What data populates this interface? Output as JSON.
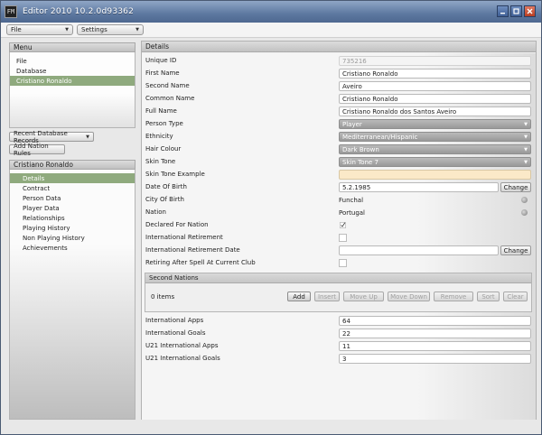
{
  "window": {
    "title": "Editor 2010 10.2.0d93362",
    "app_icon": "FM"
  },
  "menubar": {
    "file": "File",
    "settings": "Settings"
  },
  "menu_panel": {
    "title": "Menu",
    "items": [
      "File",
      "Database",
      "Cristiano Ronaldo"
    ],
    "selected_index": 2
  },
  "buttons": {
    "recent_records": "Recent Database Records",
    "add_nation_rules": "Add Nation Rules",
    "change": "Change"
  },
  "player_panel": {
    "title": "Cristiano Ronaldo",
    "items": [
      "Details",
      "Contract",
      "Person Data",
      "Player Data",
      "Relationships",
      "Playing History",
      "Non Playing History",
      "Achievements"
    ],
    "selected_index": 0
  },
  "details": {
    "title": "Details",
    "labels": {
      "unique_id": "Unique ID",
      "first_name": "First Name",
      "second_name": "Second Name",
      "common_name": "Common Name",
      "full_name": "Full Name",
      "person_type": "Person Type",
      "ethnicity": "Ethnicity",
      "hair_colour": "Hair Colour",
      "skin_tone": "Skin Tone",
      "skin_tone_example": "Skin Tone Example",
      "date_of_birth": "Date Of Birth",
      "city_of_birth": "City Of Birth",
      "nation": "Nation",
      "declared_for_nation": "Declared For Nation",
      "international_retirement": "International Retirement",
      "international_retirement_date": "International Retirement Date",
      "retiring_after_spell": "Retiring After Spell At Current Club",
      "international_apps": "International Apps",
      "international_goals": "International Goals",
      "u21_international_apps": "U21 International Apps",
      "u21_international_goals": "U21 International Goals"
    },
    "values": {
      "unique_id": "735216",
      "first_name": "Cristiano Ronaldo",
      "second_name": "Aveiro",
      "common_name": "Cristiano Ronaldo",
      "full_name": "Cristiano Ronaldo dos Santos Aveiro",
      "person_type": "Player",
      "ethnicity": "Mediterranean/Hispanic",
      "hair_colour": "Dark Brown",
      "skin_tone": "Skin Tone 7",
      "skin_tone_example": "",
      "date_of_birth": "5.2.1985",
      "city_of_birth": "Funchal",
      "nation": "Portugal",
      "international_retirement_date": "",
      "international_apps": "64",
      "international_goals": "22",
      "u21_international_apps": "11",
      "u21_international_goals": "3"
    },
    "checkboxes": {
      "declared_for_nation": true,
      "international_retirement": false,
      "retiring_after_spell": false
    }
  },
  "second_nations": {
    "title": "Second Nations",
    "count_text": "0 items",
    "buttons": [
      "Add",
      "Insert",
      "Move Up",
      "Move Down",
      "Remove",
      "Sort",
      "Clear"
    ]
  },
  "colors": {
    "selection": "#8faa7e",
    "skin_tone_swatch": "#fbe9c8",
    "titlebar": "#5d78a0"
  }
}
